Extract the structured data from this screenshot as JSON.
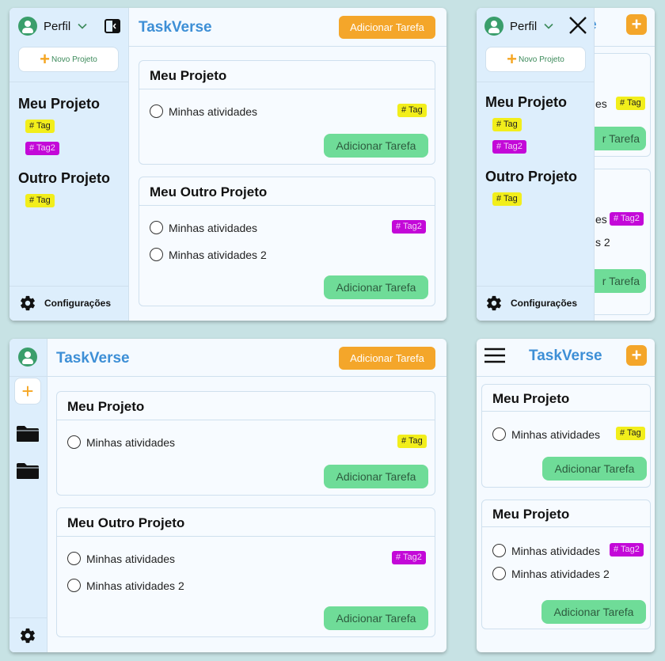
{
  "app": {
    "title": "TaskVerse"
  },
  "profile": {
    "label": "Perfil"
  },
  "sidebar": {
    "new_project": "Novo Projeto",
    "settings": "Configurações",
    "projects": [
      {
        "name": "Meu Projeto",
        "tags": [
          "# Tag",
          "# Tag2"
        ]
      },
      {
        "name": "Outro Projeto",
        "tags": [
          "# Tag"
        ]
      }
    ]
  },
  "header": {
    "add_task": "Adicionar Tarefa"
  },
  "cards": [
    {
      "title": "Meu Projeto",
      "tasks": [
        {
          "label": "Minhas atividades",
          "tag": "# Tag"
        }
      ],
      "button": "Adicionar Tarefa"
    },
    {
      "title": "Meu Outro Projeto",
      "tasks": [
        {
          "label": "Minhas atividades",
          "tag": "# Tag2"
        },
        {
          "label": "Minhas atividades 2"
        }
      ],
      "button": "Adicionar Tarefa"
    }
  ],
  "mobile_cards": [
    {
      "title": "Meu Projeto",
      "tasks": [
        {
          "label": "Minhas atividades",
          "tag": "# Tag"
        }
      ],
      "button": "Adicionar Tarefa"
    },
    {
      "title": "Meu Projeto",
      "tasks": [
        {
          "label": "Minhas atividades",
          "tag": "# Tag2"
        },
        {
          "label": "Minhas atividades 2"
        }
      ],
      "button": "Adicionar Tarefa"
    }
  ],
  "peek": {
    "title_fragment": "e",
    "task_fragment_1": "es",
    "task_fragment_2": "es",
    "task_fragment_3": "s 2",
    "button_fragment": "r Tarefa"
  },
  "colors": {
    "accent_blue": "#3d8fd6",
    "orange": "#f4a62a",
    "green": "#6fdc98",
    "tag_yellow": "#f2ee1b",
    "tag_purple": "#c308d8"
  }
}
